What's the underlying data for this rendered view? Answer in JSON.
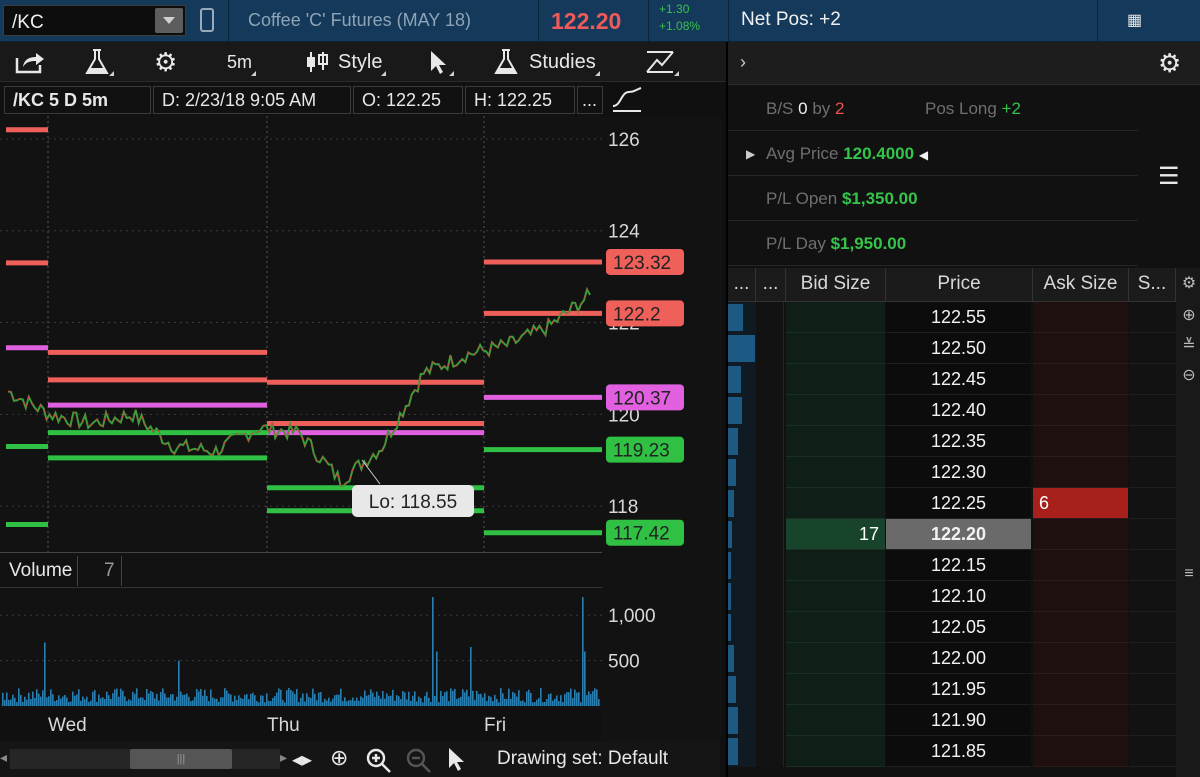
{
  "topbar": {
    "symbol": "/KC",
    "instrument_name": "Coffee 'C' Futures (MAY 18)",
    "last_price": "122.20",
    "change_abs": "+1.30",
    "change_pct": "+1.08%",
    "net_pos": "Net Pos: +2"
  },
  "toolbar": {
    "timeframe": "5m",
    "style_label": "Style",
    "studies_label": "Studies"
  },
  "chart_header": {
    "symbol_label": "/KC 5 D 5m",
    "date_label": "D: 2/23/18 9:05 AM",
    "open_label": "O: 122.25",
    "high_label": "H: 122.25",
    "more_label": "..."
  },
  "chart": {
    "price_ticks": [
      "126",
      "124",
      "122",
      "120",
      "118"
    ],
    "level_labels": [
      "123.32",
      "122.2",
      "120.37",
      "119.23",
      "117.42"
    ],
    "low_callout": "Lo: 118.55",
    "volume_label": "Volume",
    "volume_num": "7",
    "volume_ticks": [
      "1,000",
      "500"
    ],
    "day_labels": [
      "Wed",
      "Thu",
      "Fri"
    ],
    "drawing_set": "Drawing set: Default"
  },
  "chart_data": {
    "type": "line",
    "title": "/KC 5 D 5m",
    "ylim": [
      117,
      126.5
    ],
    "series": [
      {
        "x": [
          "Wed",
          "Wed",
          "Wed",
          "Wed",
          "Wed",
          "Thu",
          "Thu",
          "Thu",
          "Thu",
          "Thu",
          "Fri",
          "Fri",
          "Fri",
          "Fri",
          "Fri"
        ],
        "values": [
          120.5,
          120.0,
          119.8,
          120.0,
          119.3,
          119.2,
          119.7,
          119.6,
          118.55,
          119.3,
          120.9,
          121.3,
          121.5,
          121.9,
          122.6
        ]
      }
    ],
    "horizontal_levels": [
      {
        "value": 123.32,
        "color": "#f0605a"
      },
      {
        "value": 122.2,
        "color": "#f0605a"
      },
      {
        "value": 120.37,
        "color": "#e060e0"
      },
      {
        "value": 119.23,
        "color": "#2fc044"
      },
      {
        "value": 117.42,
        "color": "#2fc044"
      }
    ],
    "volume_ylim": [
      0,
      1300
    ]
  },
  "right_panel": {
    "bs_label": "B/S",
    "bs_value": "0",
    "bs_by": "by",
    "bs_by_value": "2",
    "pos_label": "Pos Long",
    "pos_value": "+2",
    "avg_label": "Avg Price",
    "avg_value": "120.4000",
    "plopen_label": "P/L Open",
    "plopen_value": "$1,350.00",
    "plday_label": "P/L Day",
    "plday_value": "$1,950.00"
  },
  "ladder": {
    "headers": [
      "...",
      "...",
      "Bid Size",
      "Price",
      "Ask Size",
      "S..."
    ],
    "rows": [
      {
        "price": "122.55",
        "bid": "",
        "ask": "",
        "vol": 0.55
      },
      {
        "price": "122.50",
        "bid": "",
        "ask": "",
        "vol": 0.95
      },
      {
        "price": "122.45",
        "bid": "",
        "ask": "",
        "vol": 0.45
      },
      {
        "price": "122.40",
        "bid": "",
        "ask": "",
        "vol": 0.5
      },
      {
        "price": "122.35",
        "bid": "",
        "ask": "",
        "vol": 0.35
      },
      {
        "price": "122.30",
        "bid": "",
        "ask": "",
        "vol": 0.3
      },
      {
        "price": "122.25",
        "bid": "",
        "ask": "6",
        "vol": 0.2
      },
      {
        "price": "122.20",
        "bid": "17",
        "ask": "",
        "vol": 0.15
      },
      {
        "price": "122.15",
        "bid": "",
        "ask": "",
        "vol": 0.1
      },
      {
        "price": "122.10",
        "bid": "",
        "ask": "",
        "vol": 0.1
      },
      {
        "price": "122.05",
        "bid": "",
        "ask": "",
        "vol": 0.1
      },
      {
        "price": "122.00",
        "bid": "",
        "ask": "",
        "vol": 0.2
      },
      {
        "price": "121.95",
        "bid": "",
        "ask": "",
        "vol": 0.3
      },
      {
        "price": "121.90",
        "bid": "",
        "ask": "",
        "vol": 0.35
      },
      {
        "price": "121.85",
        "bid": "",
        "ask": "",
        "vol": 0.35
      }
    ]
  }
}
